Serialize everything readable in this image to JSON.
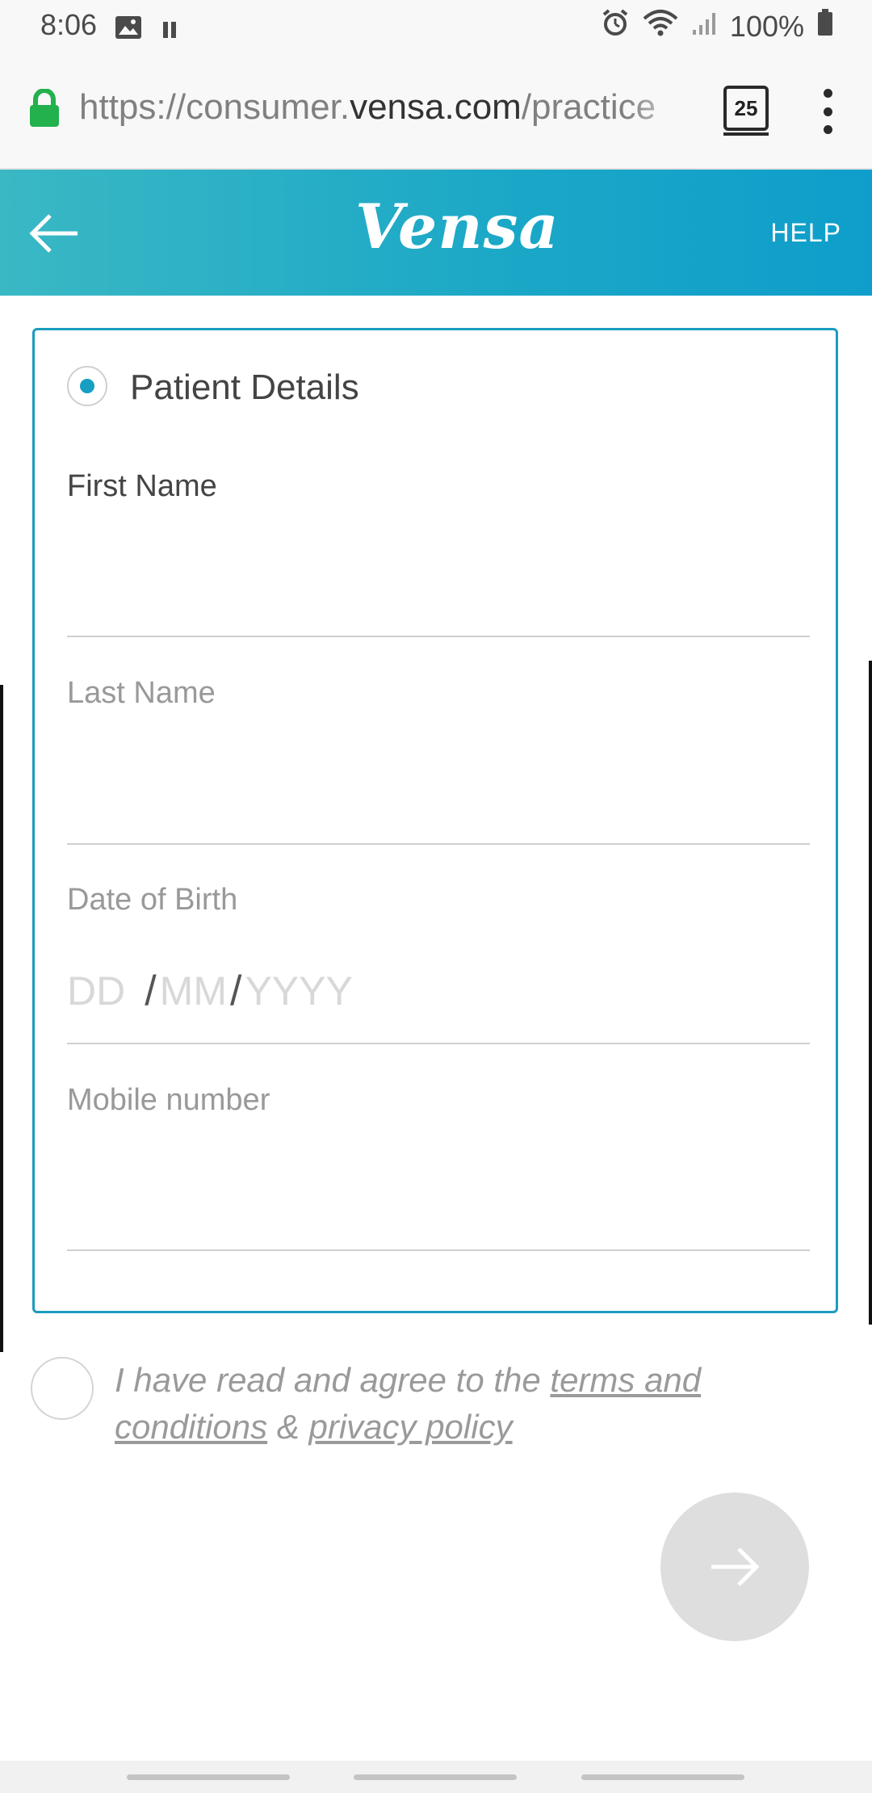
{
  "status_bar": {
    "time": "8:06",
    "battery": "100%"
  },
  "browser": {
    "url_prefix": "https://consumer.",
    "url_domain": "vensa.com",
    "url_suffix": "/practice",
    "tab_count": "25"
  },
  "header": {
    "logo": "Vensa",
    "help": "HELP"
  },
  "form": {
    "section_title": "Patient Details",
    "first_name_label": "First Name",
    "last_name_label": "Last Name",
    "dob_label": "Date of Birth",
    "dob_day_placeholder": "DD",
    "dob_month_placeholder": "MM",
    "dob_year_placeholder": "YYYY",
    "dob_separator": "/",
    "mobile_label": "Mobile number"
  },
  "terms": {
    "prefix": "I have read and agree to the ",
    "terms_link": "terms and conditions",
    "joiner": " & ",
    "privacy_link": "privacy policy"
  },
  "colors": {
    "accent": "#1a9cbf",
    "header_start": "#3ab8c4",
    "header_end": "#0f9ecb",
    "lock": "#22b14c",
    "disabled_button": "#dedede"
  }
}
